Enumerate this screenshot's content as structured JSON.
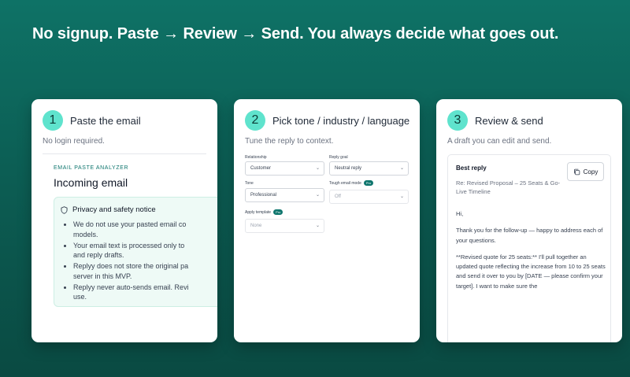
{
  "headline": "No signup. Paste → Review → Send. You always decide what goes out.",
  "colors": {
    "accent": "#5fe3cd",
    "brand": "#0f766e",
    "background": "#0c5e54"
  },
  "steps": [
    {
      "number": "1",
      "title": "Paste the email",
      "subtitle": "No login required."
    },
    {
      "number": "2",
      "title": "Pick tone / industry / language",
      "subtitle": "Tune the reply to context."
    },
    {
      "number": "3",
      "title": "Review & send",
      "subtitle": "A draft you can edit and send."
    }
  ],
  "analyzer": {
    "label": "EMAIL PASTE ANALYZER",
    "title": "Incoming email",
    "notice_title": "Privacy and safety notice",
    "notice_icon": "shield-icon",
    "bullets": [
      {
        "line1": "We do not use your pasted email co",
        "line2": "models."
      },
      {
        "line1": "Your email text is processed only to",
        "line2": "and reply drafts."
      },
      {
        "line1": "Replyy does not store the original pa",
        "line2": "server in this MVP."
      },
      {
        "line1": "Replyy never auto-sends email. Revi",
        "line2": "use."
      }
    ]
  },
  "options": {
    "relationship": {
      "label": "Relationship",
      "value": "Customer"
    },
    "reply_goal": {
      "label": "Reply goal",
      "value": "Neutral reply"
    },
    "tone": {
      "label": "Tone",
      "value": "Professional"
    },
    "tough_mode": {
      "label": "Tough email mode",
      "badge": "Pro",
      "value": "Off"
    },
    "template": {
      "label": "Apply template",
      "badge": "Pro",
      "value": "None"
    }
  },
  "reply": {
    "title": "Best reply",
    "copy_label": "Copy",
    "subject": "Re: Revised Proposal – 25 Seats & Go-Live Timeline",
    "greeting": "Hi,",
    "para1": "Thank you for the follow-up — happy to address each of your questions.",
    "para2": "**Revised quote for 25 seats:** I'll pull together an updated quote reflecting the increase from 10 to 25 seats and send it over to you by [DATE — please confirm your target]. I want to make sure the"
  }
}
